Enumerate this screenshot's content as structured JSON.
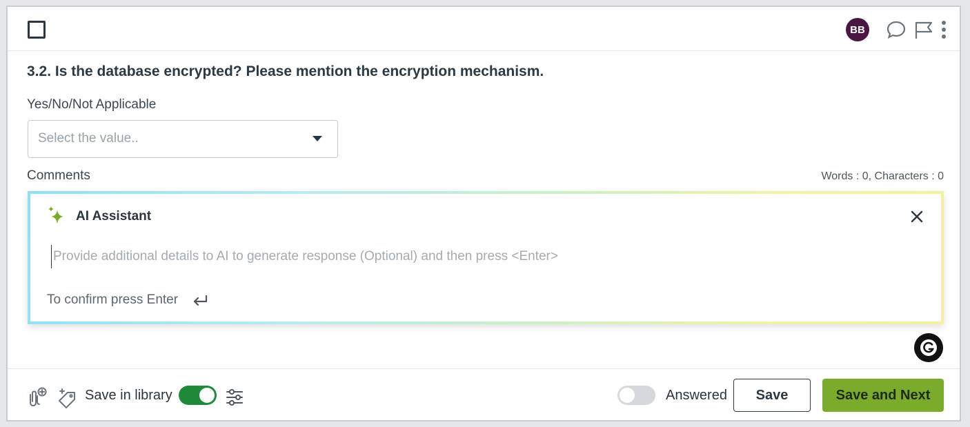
{
  "header": {
    "avatar_initials": "BB",
    "avatar_color": "#4a1744",
    "icons": [
      "comment-icon",
      "flag-icon",
      "more-vertical-icon"
    ]
  },
  "question": {
    "title": "3.2. Is the database encrypted? Please mention the encryption mechanism.",
    "select_label": "Yes/No/Not Applicable",
    "select_placeholder": "Select the value..",
    "comments_label": "Comments",
    "counter": "Words : 0, Characters : 0"
  },
  "ai_assistant": {
    "title": "AI Assistant",
    "input_placeholder": "Provide additional details to AI to generate response (Optional) and then press <Enter>",
    "confirm_hint": "To confirm press Enter"
  },
  "footer": {
    "save_in_library_label": "Save in library",
    "save_in_library_on": true,
    "answered_label": "Answered",
    "answered_on": false,
    "save_label": "Save",
    "save_next_label": "Save and Next",
    "accent_color": "#7bab2b",
    "toggle_on_color": "#1f8a3a"
  }
}
